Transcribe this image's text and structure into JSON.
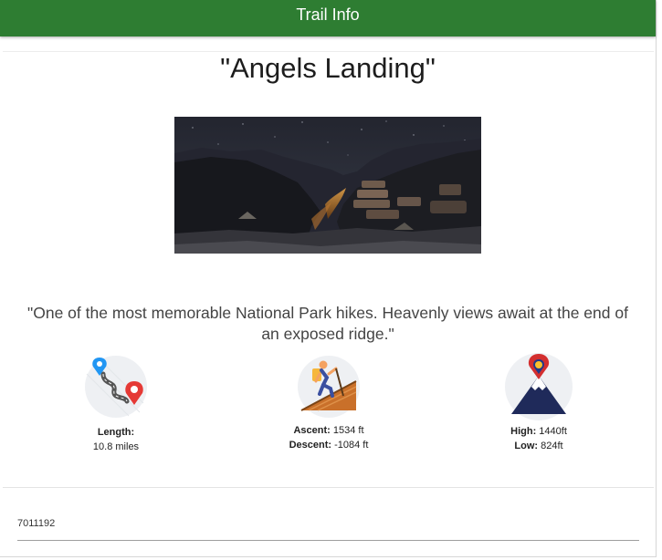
{
  "app_bar": {
    "title": "Trail Info"
  },
  "trail": {
    "name": "\"Angels Landing\"",
    "description": "\"One of the most memorable National Park hikes. Heavenly views await at the end of an exposed ridge.\"",
    "photo_icon": "night-canyon-photo"
  },
  "stats": {
    "length": {
      "label": "Length:",
      "value": "10.8 miles",
      "icon": "route-map-pins-icon"
    },
    "ascent": {
      "label": "Ascent:",
      "value": " 1534 ft"
    },
    "descent": {
      "label": "Descent:",
      "value": " -1084 ft"
    },
    "elevation_icon": "hiker-climbing-icon",
    "high": {
      "label": "High:",
      "value": " 1440ft"
    },
    "low": {
      "label": "Low:",
      "value": " 824ft"
    },
    "altitude_icon": "mountain-peak-pin-icon"
  },
  "footer": {
    "trail_id": "7011192"
  },
  "colors": {
    "app_bar": "#2e7d32",
    "divider": "#e4e4e4"
  }
}
